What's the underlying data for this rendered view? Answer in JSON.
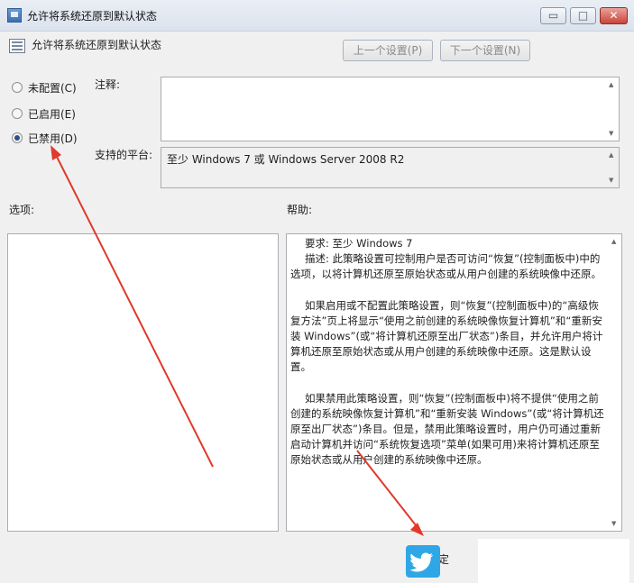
{
  "window": {
    "title": "允许将系统还原到默认状态",
    "controls": {
      "minimize": "▭",
      "maximize": "□",
      "close": "✕"
    }
  },
  "header": {
    "policy_name": "允许将系统还原到默认状态",
    "prev_button": "上一个设置(P)",
    "next_button": "下一个设置(N)"
  },
  "state_options": [
    {
      "label": "未配置(C)",
      "checked": false
    },
    {
      "label": "已启用(E)",
      "checked": false
    },
    {
      "label": "已禁用(D)",
      "checked": true
    }
  ],
  "comment": {
    "label": "注释:",
    "value": ""
  },
  "platform": {
    "label": "支持的平台:",
    "value": "至少 Windows 7 或 Windows Server 2008 R2"
  },
  "options": {
    "label": "选项:"
  },
  "help": {
    "label": "帮助:",
    "paragraphs": [
      "要求: 至少 Windows 7",
      "描述: 此策略设置可控制用户是否可访问“恢复”(控制面板中)中的选项，以将计算机还原至原始状态或从用户创建的系统映像中还原。",
      "如果启用或不配置此策略设置，则“恢复”(控制面板中)的“高级恢复方法”页上将显示“使用之前创建的系统映像恢复计算机”和“重新安装 Windows”(或“将计算机还原至出厂状态”)条目，并允许用户将计算机还原至原始状态或从用户创建的系统映像中还原。这是默认设置。",
      "如果禁用此策略设置，则“恢复”(控制面板中)将不提供“使用之前创建的系统映像恢复计算机”和“重新安装 Windows”(或“将计算机还原至出厂状态”)条目。但是，禁用此策略设置时，用户仍可通过重新启动计算机并访问“系统恢复选项”菜单(如果可用)来将计算机还原至原始状态或从用户创建的系统映像中还原。"
    ]
  },
  "footer": {
    "ok_button": "定"
  },
  "colors": {
    "annotation_arrow": "#e03a2a",
    "twitter_blue": "#2fa7e6"
  }
}
